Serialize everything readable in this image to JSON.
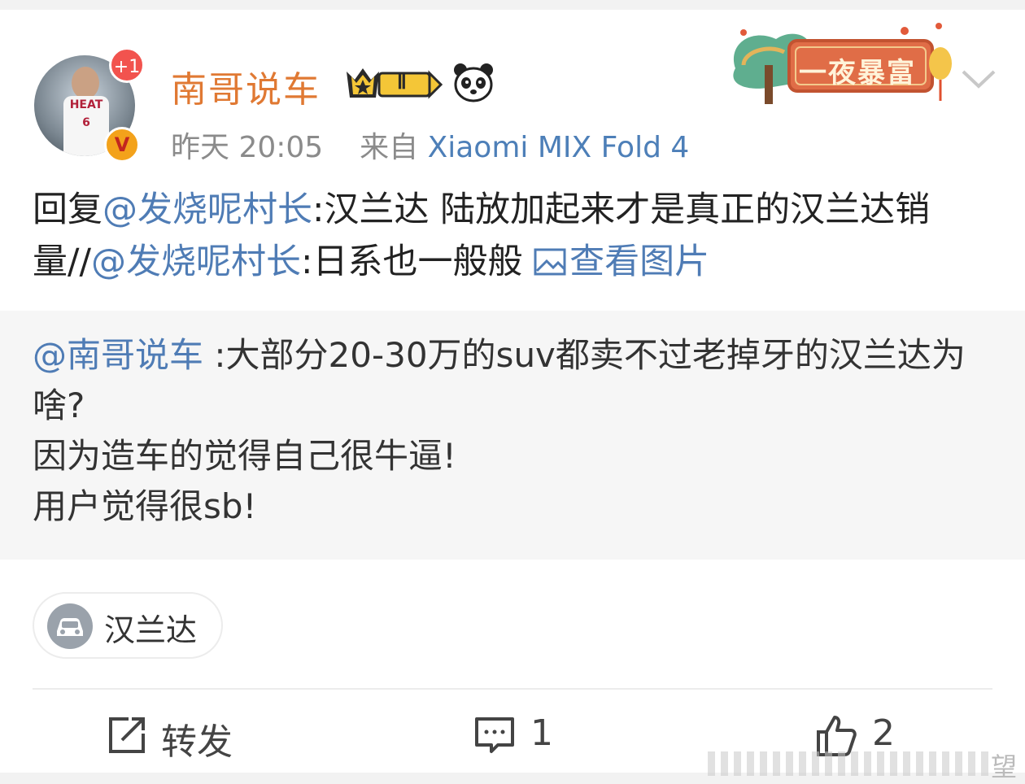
{
  "post": {
    "username": "南哥说车",
    "notification_badge": "+1",
    "verified_badge": "V",
    "level_badge": "Ⅱ",
    "time": "昨天 20:05",
    "source_prefix": "来自",
    "device": "Xiaomi MIX Fold 4",
    "banner_text": "一夜暴富",
    "reply_prefix": "回复",
    "mention_1": "@发烧呢村长",
    "text_1": ":汉兰达 陆放加起来才是真正的汉兰达销量//",
    "mention_2": "@发烧呢村长",
    "text_2": ":日系也一般般 ",
    "view_picture": "查看图片"
  },
  "quoted": {
    "mention": "@南哥说车",
    "text": " :大部分20-30万的suv都卖不过老掉牙的汉兰达为啥?",
    "line_2": "因为造车的觉得自己很牛逼!",
    "line_3": "用户觉得很sb!"
  },
  "topic": {
    "label": "汉兰达"
  },
  "actions": {
    "repost_label": "转发",
    "comment_count": "1",
    "like_count": "2"
  },
  "watermark": {
    "char": "望"
  },
  "colors": {
    "username": "#e07933",
    "link": "#4f7cb5",
    "meta": "#8b8b8b",
    "quote_bg": "#f6f6f6"
  }
}
